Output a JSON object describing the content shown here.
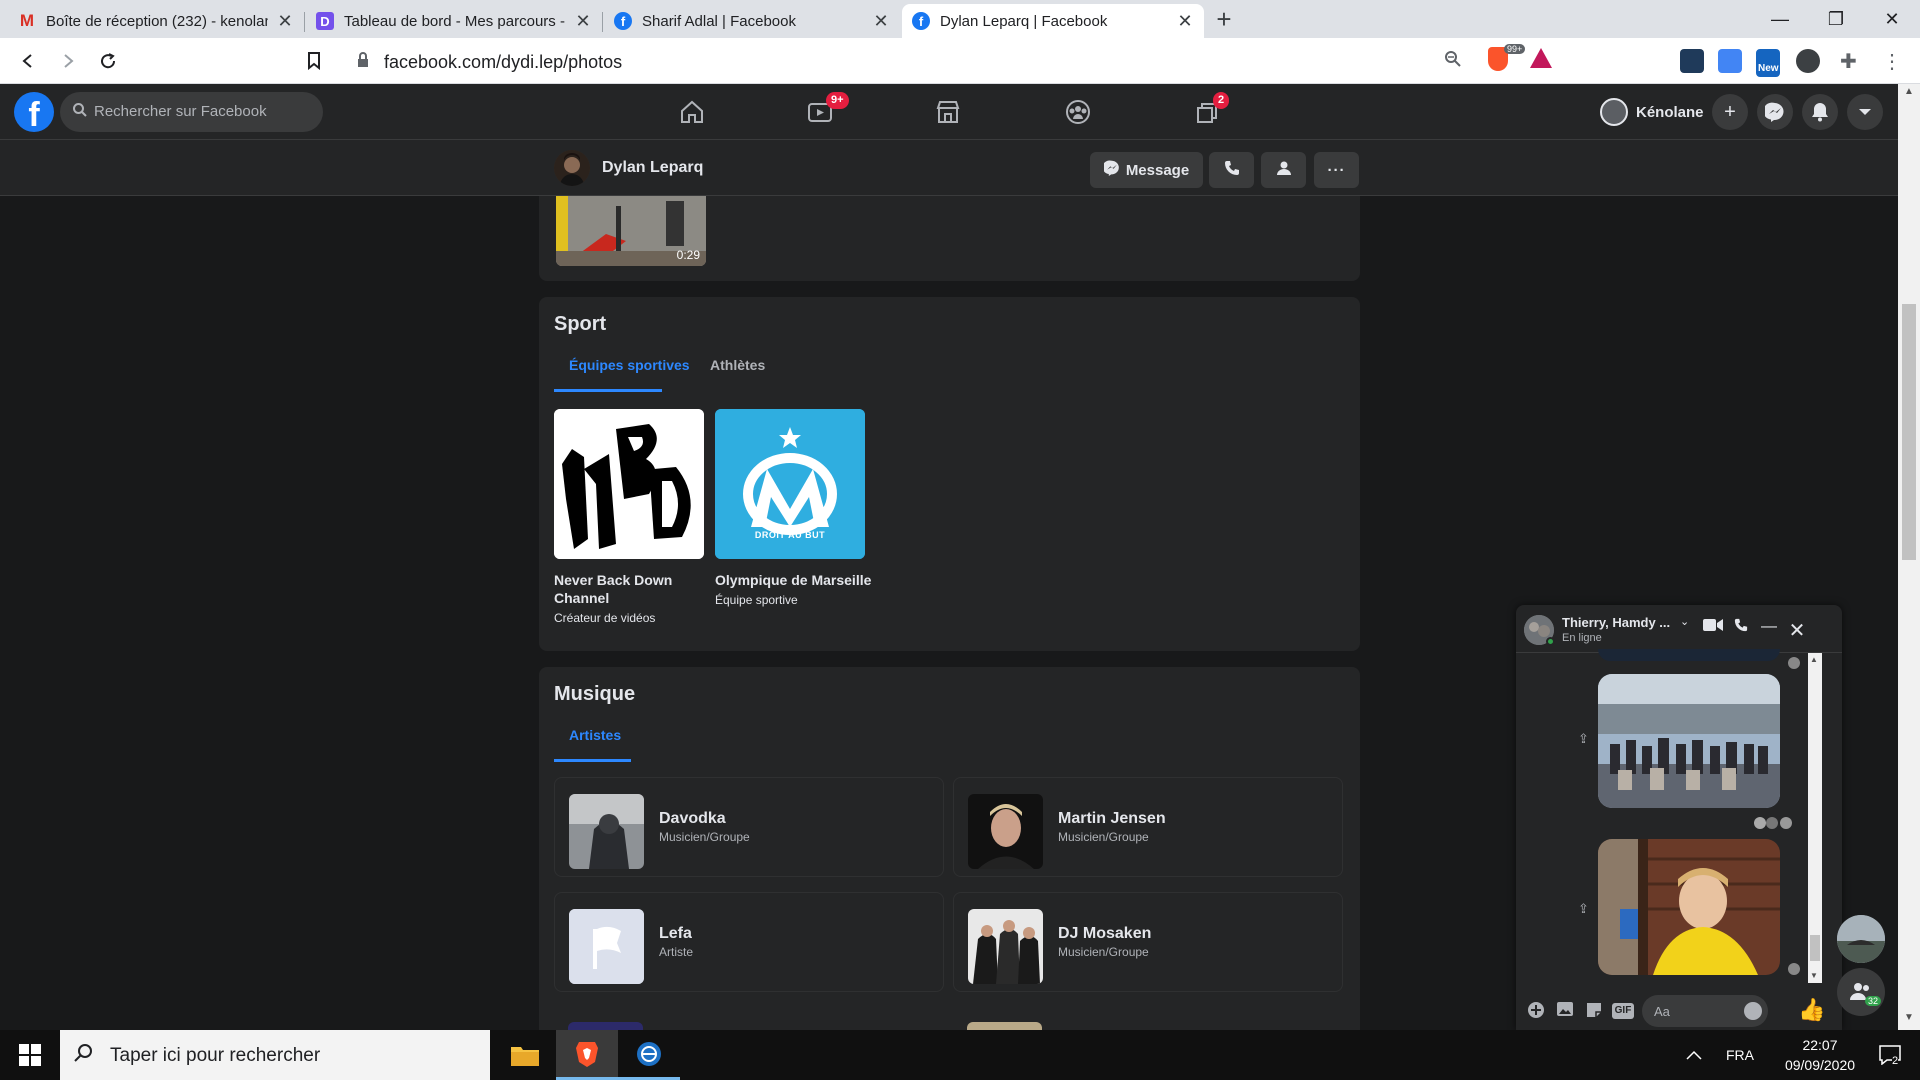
{
  "browser": {
    "tabs": [
      {
        "title": "Boîte de réception (232) - kenolan",
        "favicon": "gmail-icon",
        "active": false
      },
      {
        "title": "Tableau de bord - Mes parcours - (",
        "favicon": "openclassrooms-icon",
        "active": false
      },
      {
        "title": "Sharif Adlal | Facebook",
        "favicon": "facebook-icon",
        "active": false
      },
      {
        "title": "Dylan Leparq | Facebook",
        "favicon": "facebook-icon",
        "active": true
      }
    ],
    "new_tab_label": "+",
    "url": "facebook.com/dydi.lep/photos",
    "brave_badge": "99+",
    "extension_new_label": "New"
  },
  "facebook": {
    "search_placeholder": "Rechercher sur Facebook",
    "nav_badges": {
      "watch": "9+",
      "gaming": "2"
    },
    "user_name": "Kénolane",
    "colors": {
      "accent": "#2d88ff",
      "brand": "#1877f2",
      "badge": "#e41e3f"
    }
  },
  "profile": {
    "name": "Dylan Leparq",
    "message_button": "Message"
  },
  "video": {
    "duration": "0:29"
  },
  "sport": {
    "title": "Sport",
    "tabs": [
      "Équipes sportives",
      "Athlètes"
    ],
    "items": [
      {
        "name": "Never Back Down Channel",
        "category": "Créateur de vidéos",
        "logo_text": "nBD"
      },
      {
        "name": "Olympique de Marseille",
        "category": "Équipe sportive",
        "logo_text": "DROIT AU BUT"
      }
    ]
  },
  "music": {
    "title": "Musique",
    "tabs": [
      "Artistes"
    ],
    "artists": [
      {
        "name": "Davodka",
        "category": "Musicien/Groupe"
      },
      {
        "name": "Martin Jensen",
        "category": "Musicien/Groupe"
      },
      {
        "name": "Lefa",
        "category": "Artiste"
      },
      {
        "name": "DJ Mosaken",
        "category": "Musicien/Groupe"
      }
    ]
  },
  "chat": {
    "title": "Thierry, Hamdy ...",
    "status": "En ligne",
    "input_placeholder": "Aa",
    "gif_label": "GIF",
    "contacts_badge": "32"
  },
  "taskbar": {
    "search_placeholder": "Taper ici pour rechercher",
    "language": "FRA",
    "time": "22:07",
    "date": "09/09/2020",
    "notifications": "2"
  }
}
